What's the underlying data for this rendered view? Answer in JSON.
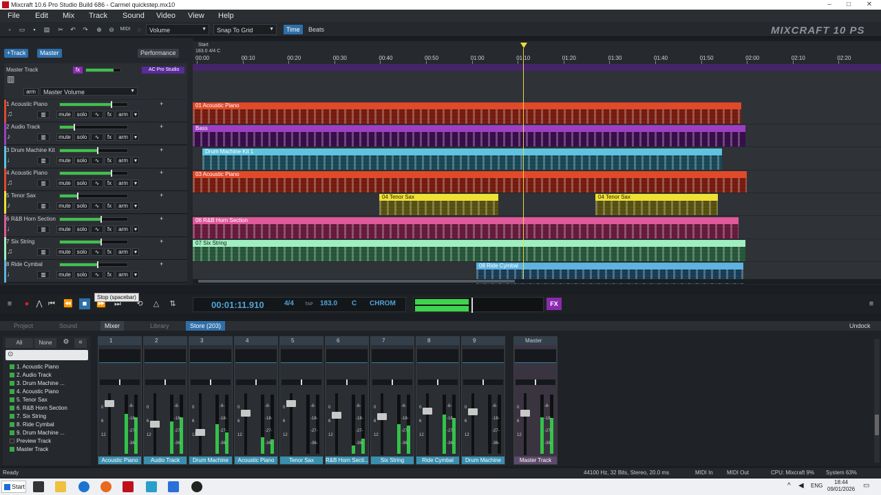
{
  "window": {
    "title": "Mixcraft 10.6 Pro Studio Build 686 - Carmel quickstep.mx10"
  },
  "menu": [
    "File",
    "Edit",
    "Mix",
    "Track",
    "Sound",
    "Video",
    "View",
    "Help"
  ],
  "toolbar": {
    "volume_drop": "Volume",
    "snap_drop": "Snap To Grid",
    "time_btn": "Time",
    "beats_btn": "Beats",
    "midi_label": "MIDI"
  },
  "logo": "MIXCRAFT 10 PS",
  "header": {
    "add_track": "+Track",
    "master": "Master",
    "performance": "Performance"
  },
  "master_track": {
    "label": "Master Track",
    "plugin": "AC Pro Studio",
    "arm": "arm",
    "dropdown": "Master Volume",
    "fx": "fx"
  },
  "button_labels": {
    "mute": "mute",
    "solo": "solo",
    "fx": "fx",
    "arm": "arm"
  },
  "tracks": [
    {
      "num": "1",
      "name": "Acoustic Piano",
      "icon": "♫",
      "vol": 0.75,
      "pan": 0.5
    },
    {
      "num": "2",
      "name": "Audio Track",
      "icon": "♪",
      "vol": 0.2,
      "pan": 0.5
    },
    {
      "num": "3",
      "name": "Drum Machine Kit",
      "icon": "♩",
      "vol": 0.55,
      "pan": 0.5
    },
    {
      "num": "4",
      "name": "Acoustic Piano",
      "icon": "♫",
      "vol": 0.75,
      "pan": 0.5
    },
    {
      "num": "5",
      "name": "Tenor Sax",
      "icon": "♪",
      "vol": 0.25,
      "pan": 0.5
    },
    {
      "num": "6",
      "name": "R&B Horn Section",
      "icon": "♩",
      "vol": 0.6,
      "pan": 0.5
    },
    {
      "num": "7",
      "name": "Six String",
      "icon": "♫",
      "vol": 0.6,
      "pan": 0.5
    },
    {
      "num": "8",
      "name": "Ride Cymbal",
      "icon": "♩",
      "vol": 0.55,
      "pan": 0.5
    }
  ],
  "ruler": {
    "start_label": "Start",
    "info": "183.0 4/4 C",
    "ticks": [
      "00:00",
      "00:10",
      "00:20",
      "00:30",
      "00:40",
      "00:50",
      "01:00",
      "01:10",
      "01:20",
      "01:30",
      "01:40",
      "01:50",
      "02:00",
      "02:10",
      "02:20"
    ]
  },
  "clips": [
    [
      {
        "name": "01 Acoustic Piano",
        "color": "#e0492a",
        "body": "#7a1d10",
        "start": 0,
        "end": 0.797
      }
    ],
    [
      {
        "name": "Bass",
        "color": "#9d3fc0",
        "body": "#3a0d4e",
        "start": 0,
        "end": 0.803
      }
    ],
    [
      {
        "name": "Drum Machine Kit 1",
        "color": "#5fc3e0",
        "body": "#1a4b5a",
        "start": 0.014,
        "end": 0.769
      }
    ],
    [
      {
        "name": "03 Acoustic Piano",
        "color": "#e0492a",
        "body": "#7a1d10",
        "start": 0,
        "end": 0.805
      }
    ],
    [
      {
        "name": "04 Tenor Sax",
        "color": "#efe034",
        "body": "#5a5410",
        "start": 0.271,
        "end": 0.444
      },
      {
        "name": "04 Tenor Sax",
        "color": "#efe034",
        "body": "#5a5410",
        "start": 0.585,
        "end": 0.763
      }
    ],
    [
      {
        "name": "06 R&B Horn Section",
        "color": "#e0599a",
        "body": "#6a1b3e",
        "start": 0,
        "end": 0.793
      }
    ],
    [
      {
        "name": "07 Six String",
        "color": "#9fefc0",
        "body": "#275a3c",
        "start": 0,
        "end": 0.803
      }
    ],
    [
      {
        "name": "08 Ride Cymbal",
        "color": "#5fb3e0",
        "body": "#1a3f5a",
        "start": 0.412,
        "end": 0.8
      }
    ]
  ],
  "transport": {
    "time": "00:01:11.910",
    "signature": "4/4",
    "tap": "TAP",
    "tempo": "183.0",
    "key": "C",
    "scale": "CHROM",
    "fx": "FX",
    "tooltip": "Stop (spacebar)"
  },
  "tabs": [
    "Project",
    "Sound",
    "Mixer",
    "Library",
    "Store (203)"
  ],
  "undock": "Undock",
  "mixer": {
    "all": "All",
    "none": "None",
    "list": [
      "1. Acoustic Piano",
      "2. Audio Track",
      "3. Drum Machine ...",
      "4. Acoustic Piano",
      "5. Tenor Sax",
      "6. R&B Horn Section",
      "7. Six String",
      "8. Ride Cymbal",
      "9. Drum Machine ...",
      "Preview Track",
      "Master Track"
    ],
    "strips": [
      {
        "num": "1",
        "name": "Acoustic Piano",
        "fader": 0.12,
        "l": 0.68,
        "r": 0.62
      },
      {
        "num": "2",
        "name": "Audio Track",
        "fader": 0.5,
        "l": 0.55,
        "r": 0.62
      },
      {
        "num": "3",
        "name": "Drum Machine",
        "fader": 0.65,
        "l": 0.5,
        "r": 0.36
      },
      {
        "num": "4",
        "name": "Acoustic Piano",
        "fader": 0.3,
        "l": 0.28,
        "r": 0.24
      },
      {
        "num": "5",
        "name": "Tenor Sax",
        "fader": 0.12,
        "l": 0.0,
        "r": 0.0
      },
      {
        "num": "6",
        "name": "R&B Horn Secti...",
        "fader": 0.34,
        "l": 0.14,
        "r": 0.26
      },
      {
        "num": "7",
        "name": "Six String",
        "fader": 0.36,
        "l": 0.5,
        "r": 0.48
      },
      {
        "num": "8",
        "name": "Ride Cymbal",
        "fader": 0.26,
        "l": 0.66,
        "r": 0.6
      },
      {
        "num": "9",
        "name": "Drum Machine",
        "fader": 0.28,
        "l": 0.0,
        "r": 0.0
      }
    ],
    "master": {
      "label": "Master",
      "name": "Master Track",
      "fader": 0.3,
      "l": 0.62,
      "r": 0.6
    },
    "meter_labels": [
      "-8-",
      "-18-",
      "-27-",
      "-36-"
    ],
    "fader_labels": [
      "0",
      "6",
      "12"
    ]
  },
  "status": {
    "ready": "Ready",
    "audio": "44100 Hz, 32 Bits, Stereo, 20.0 ms",
    "midi_in": "MIDI In",
    "midi_out": "MIDI Out",
    "cpu": "CPU: Mixcraft 9%",
    "system": "System 63%"
  },
  "taskbar": {
    "start": "Start",
    "lang": "ENG",
    "time": "18:44",
    "date": "09/01/2026"
  },
  "colors": {
    "accent": "#3a8fae",
    "record": "#e02020",
    "fx": "#8b2ab0"
  }
}
